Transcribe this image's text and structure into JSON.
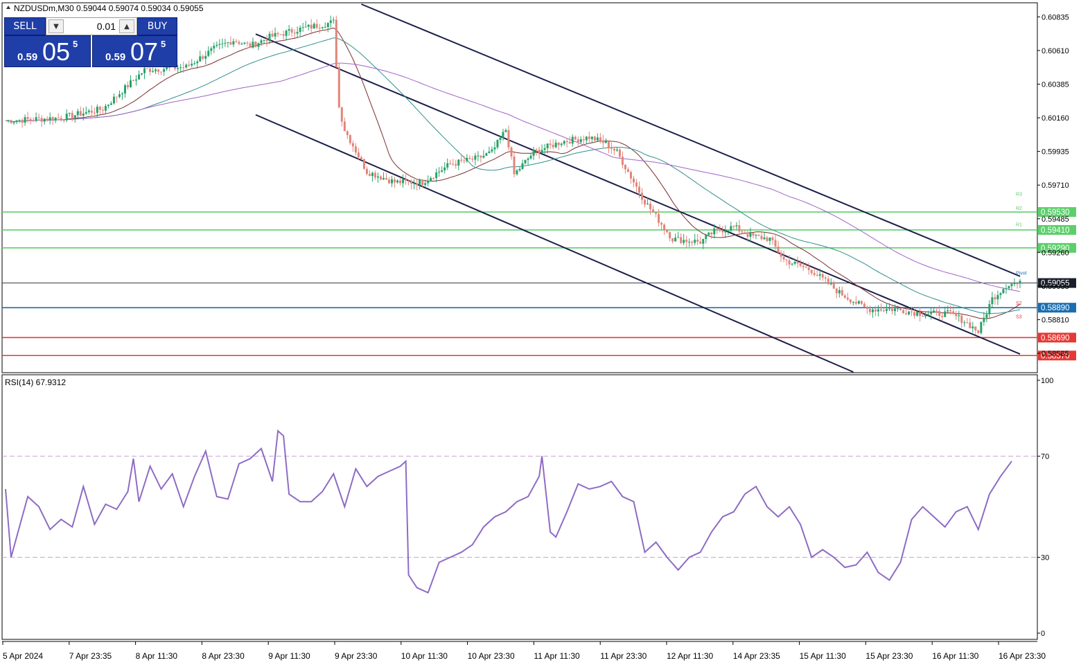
{
  "symbol_line": "NZDUSDm,M30  0.59044 0.59074 0.59034 0.59055",
  "trade_panel": {
    "sell_label": "SELL",
    "buy_label": "BUY",
    "lot": "0.01",
    "sell_price": {
      "small": "0.59",
      "big": "05",
      "sup": "5"
    },
    "buy_price": {
      "small": "0.59",
      "big": "07",
      "sup": "5"
    }
  },
  "colors": {
    "bull": "#26a269",
    "bear": "#e2847a",
    "channel": "#1b1f4a",
    "resistance": "#5ccf6b",
    "support": "#e53935",
    "current": "#1b6fb0",
    "ma_fast": "#7a2d2d",
    "ma_mid": "#2f8f8a",
    "ma_slow": "#a063c8",
    "rsi": "#8e6bc4"
  },
  "chart_data": [
    {
      "type": "candlestick",
      "title": "NZDUSDm,M30",
      "ylim": [
        0.5846,
        0.6092
      ],
      "price_axis_ticks": [
        "0.60835",
        "0.60610",
        "0.60385",
        "0.60160",
        "0.59935",
        "0.59710",
        "0.59485",
        "0.59260",
        "0.59035",
        "0.58810",
        "0.58585"
      ],
      "x_tick_labels": [
        "5 Apr 2024",
        "7 Apr 23:35",
        "8 Apr 11:30",
        "8 Apr 23:30",
        "9 Apr 11:30",
        "9 Apr 23:30",
        "10 Apr 11:30",
        "10 Apr 23:30",
        "11 Apr 11:30",
        "11 Apr 23:30",
        "12 Apr 11:30",
        "14 Apr 23:35",
        "15 Apr 11:30",
        "15 Apr 23:30",
        "16 Apr 11:30",
        "16 Apr 23:30"
      ],
      "close_path": [
        [
          0,
          0.6014
        ],
        [
          20,
          0.6016
        ],
        [
          35,
          0.6022
        ],
        [
          50,
          0.6048
        ],
        [
          65,
          0.605
        ],
        [
          75,
          0.6062
        ],
        [
          82,
          0.6068
        ],
        [
          88,
          0.6064
        ],
        [
          95,
          0.607
        ],
        [
          105,
          0.6075
        ],
        [
          118,
          0.608
        ],
        [
          120,
          0.6023
        ],
        [
          122,
          0.6008
        ],
        [
          130,
          0.598
        ],
        [
          140,
          0.5973
        ],
        [
          150,
          0.5973
        ],
        [
          160,
          0.5985
        ],
        [
          170,
          0.5989
        ],
        [
          175,
          0.5993
        ],
        [
          180,
          0.6008
        ],
        [
          183,
          0.5978
        ],
        [
          190,
          0.5993
        ],
        [
          200,
          0.6
        ],
        [
          210,
          0.6003
        ],
        [
          216,
          0.5999
        ],
        [
          220,
          0.5993
        ],
        [
          230,
          0.596
        ],
        [
          240,
          0.5935
        ],
        [
          250,
          0.5933
        ],
        [
          255,
          0.594
        ],
        [
          262,
          0.5943
        ],
        [
          268,
          0.5937
        ],
        [
          275,
          0.5935
        ],
        [
          280,
          0.5921
        ],
        [
          290,
          0.5914
        ],
        [
          300,
          0.5899
        ],
        [
          310,
          0.5888
        ],
        [
          320,
          0.5888
        ],
        [
          330,
          0.5885
        ],
        [
          340,
          0.5885
        ],
        [
          345,
          0.588
        ],
        [
          350,
          0.5873
        ],
        [
          355,
          0.5895
        ],
        [
          360,
          0.5904
        ],
        [
          362,
          0.5905
        ]
      ],
      "horizontal_levels": [
        {
          "label": "0.59530",
          "value": 0.5953,
          "color": "#5ccf6b",
          "tag": "R2"
        },
        {
          "label": "0.59410",
          "value": 0.5941,
          "color": "#5ccf6b",
          "tag": "R1"
        },
        {
          "label": "0.59290",
          "value": 0.5929,
          "color": "#5ccf6b",
          "tag": ""
        },
        {
          "label": "0.59055",
          "value": 0.59055,
          "color": "#1b1f2a",
          "tag": "Pivot"
        },
        {
          "label": "0.58890",
          "value": 0.5889,
          "color": "#1b6fb0",
          "tag": "S2"
        },
        {
          "label": "0.58690",
          "value": 0.5869,
          "color": "#e53935",
          "tag": "S3"
        },
        {
          "label": "0.58570",
          "value": 0.5857,
          "color": "#e53935",
          "tag": ""
        }
      ],
      "level_tags": [
        "R3",
        "R2",
        "R1",
        "Pivot",
        "S2",
        "S3"
      ],
      "channel_lines": [
        {
          "from": [
            128,
            0.6092
          ],
          "to": [
            365,
            0.591
          ]
        },
        {
          "from": [
            90,
            0.6072
          ],
          "to": [
            365,
            0.5858
          ]
        },
        {
          "from": [
            90,
            0.6018
          ],
          "to": [
            305,
            0.5846
          ]
        }
      ]
    },
    {
      "type": "line",
      "title": "RSI(14) 67.9312",
      "ylim": [
        0,
        100
      ],
      "y_ticks": [
        "100",
        "70",
        "30",
        "0"
      ],
      "levels": [
        70,
        30
      ],
      "values": [
        [
          0,
          57
        ],
        [
          2,
          30
        ],
        [
          4,
          38
        ],
        [
          8,
          54
        ],
        [
          12,
          50
        ],
        [
          16,
          41
        ],
        [
          20,
          45
        ],
        [
          24,
          42
        ],
        [
          28,
          58
        ],
        [
          32,
          43
        ],
        [
          36,
          51
        ],
        [
          40,
          49
        ],
        [
          44,
          56
        ],
        [
          46,
          69
        ],
        [
          48,
          52
        ],
        [
          52,
          66
        ],
        [
          56,
          57
        ],
        [
          60,
          63
        ],
        [
          64,
          50
        ],
        [
          68,
          62
        ],
        [
          72,
          72
        ],
        [
          76,
          54
        ],
        [
          80,
          53
        ],
        [
          84,
          67
        ],
        [
          88,
          69
        ],
        [
          92,
          73
        ],
        [
          96,
          60
        ],
        [
          98,
          80
        ],
        [
          100,
          78
        ],
        [
          102,
          55
        ],
        [
          106,
          52
        ],
        [
          110,
          52
        ],
        [
          114,
          56
        ],
        [
          118,
          63
        ],
        [
          122,
          50
        ],
        [
          126,
          65
        ],
        [
          130,
          58
        ],
        [
          134,
          62
        ],
        [
          138,
          64
        ],
        [
          142,
          66
        ],
        [
          144,
          68
        ],
        [
          145,
          23
        ],
        [
          148,
          18
        ],
        [
          152,
          16
        ],
        [
          156,
          28
        ],
        [
          160,
          30
        ],
        [
          164,
          32
        ],
        [
          168,
          35
        ],
        [
          172,
          42
        ],
        [
          176,
          46
        ],
        [
          180,
          48
        ],
        [
          184,
          52
        ],
        [
          188,
          54
        ],
        [
          192,
          62
        ],
        [
          193,
          70
        ],
        [
          196,
          40
        ],
        [
          198,
          38
        ],
        [
          202,
          48
        ],
        [
          206,
          59
        ],
        [
          210,
          57
        ],
        [
          214,
          58
        ],
        [
          218,
          60
        ],
        [
          222,
          54
        ],
        [
          226,
          52
        ],
        [
          230,
          32
        ],
        [
          234,
          36
        ],
        [
          238,
          30
        ],
        [
          242,
          25
        ],
        [
          246,
          30
        ],
        [
          250,
          32
        ],
        [
          254,
          40
        ],
        [
          258,
          46
        ],
        [
          262,
          48
        ],
        [
          266,
          55
        ],
        [
          270,
          58
        ],
        [
          274,
          50
        ],
        [
          278,
          46
        ],
        [
          282,
          50
        ],
        [
          286,
          43
        ],
        [
          290,
          30
        ],
        [
          294,
          33
        ],
        [
          298,
          30
        ],
        [
          302,
          26
        ],
        [
          306,
          27
        ],
        [
          310,
          32
        ],
        [
          314,
          24
        ],
        [
          318,
          21
        ],
        [
          322,
          28
        ],
        [
          326,
          45
        ],
        [
          330,
          50
        ],
        [
          334,
          46
        ],
        [
          338,
          42
        ],
        [
          342,
          48
        ],
        [
          346,
          50
        ],
        [
          350,
          41
        ],
        [
          354,
          55
        ],
        [
          358,
          62
        ],
        [
          362,
          68
        ]
      ]
    }
  ]
}
